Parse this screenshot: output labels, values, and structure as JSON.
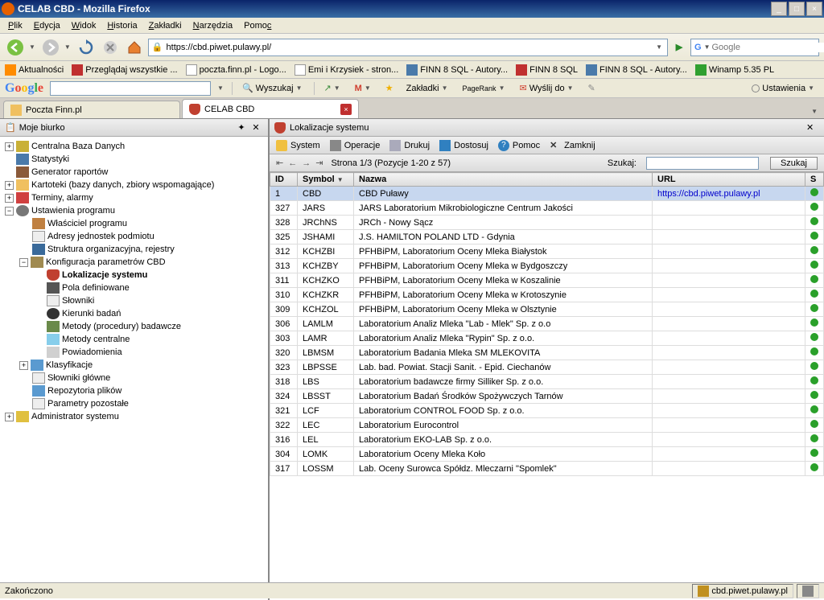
{
  "window": {
    "title": "CELAB CBD - Mozilla Firefox",
    "min": "_",
    "max": "□",
    "close": "×"
  },
  "menubar": [
    "Plik",
    "Edycja",
    "Widok",
    "Historia",
    "Zakładki",
    "Narzędzia",
    "Pomoc"
  ],
  "url": "https://cbd.piwet.pulawy.pl/",
  "search_placeholder": "Google",
  "bookmarks": [
    "Aktualności",
    "Przeglądaj wszystkie ...",
    "poczta.finn.pl - Logo...",
    "Emi i Krzysiek - stron...",
    "FINN 8 SQL - Autory...",
    "FINN 8 SQL",
    "FINN 8 SQL - Autory...",
    "Winamp 5.35 PL"
  ],
  "google": {
    "search": "Wyszukaj",
    "bookmarks": "Zakładki",
    "pagerank": "PageRank",
    "send": "Wyślij do",
    "settings": "Ustawienia"
  },
  "tabs": [
    {
      "label": "Poczta Finn.pl",
      "active": false
    },
    {
      "label": "CELAB CBD",
      "active": true
    }
  ],
  "sidebar": {
    "title": "Moje biurko",
    "tree": {
      "n1": "Centralna Baza Danych",
      "n2": "Statystyki",
      "n3": "Generator raportów",
      "n4": "Kartoteki (bazy danych, zbiory wspomagające)",
      "n5": "Terminy, alarmy",
      "n6": "Ustawienia programu",
      "n7": "Właściciel programu",
      "n8": "Adresy jednostek podmiotu",
      "n9": "Struktura organizacyjna, rejestry",
      "n10": "Konfiguracja parametrów CBD",
      "n11": "Lokalizacje systemu",
      "n12": "Pola definiowane",
      "n13": "Słowniki",
      "n14": "Kierunki badań",
      "n15": "Metody (procedury) badawcze",
      "n16": "Metody centralne",
      "n17": "Powiadomienia",
      "n18": "Klasyfikacje",
      "n19": "Słowniki główne",
      "n20": "Repozytoria plików",
      "n21": "Parametry pozostałe",
      "n22": "Administrator systemu"
    }
  },
  "content": {
    "title": "Lokalizacje systemu",
    "toolbar": {
      "system": "System",
      "ops": "Operacje",
      "print": "Drukuj",
      "adjust": "Dostosuj",
      "help": "Pomoc",
      "close": "Zamknij"
    },
    "pager": {
      "text": "Strona 1/3 (Pozycje 1-20 z 57)",
      "search_label": "Szukaj:",
      "search_btn": "Szukaj"
    },
    "columns": {
      "id": "ID",
      "symbol": "Symbol",
      "nazwa": "Nazwa",
      "url": "URL",
      "s": "S"
    },
    "rows": [
      {
        "id": "1",
        "sym": "CBD",
        "name": "CBD Puławy",
        "url": "https://cbd.piwet.pulawy.pl"
      },
      {
        "id": "327",
        "sym": "JARS",
        "name": "JARS Laboratorium Mikrobiologiczne Centrum Jakości",
        "url": ""
      },
      {
        "id": "328",
        "sym": "JRChNS",
        "name": "JRCh - Nowy Sącz",
        "url": ""
      },
      {
        "id": "325",
        "sym": "JSHAMI",
        "name": "J.S. HAMILTON POLAND LTD - Gdynia",
        "url": ""
      },
      {
        "id": "312",
        "sym": "KCHZBI",
        "name": "PFHBiPM, Laboratorium Oceny Mleka Białystok",
        "url": ""
      },
      {
        "id": "313",
        "sym": "KCHZBY",
        "name": "PFHBiPM, Laboratorium Oceny Mleka w Bydgoszczy",
        "url": ""
      },
      {
        "id": "311",
        "sym": "KCHZKO",
        "name": "PFHBiPM, Laboratorium Oceny Mleka w Koszalinie",
        "url": ""
      },
      {
        "id": "310",
        "sym": "KCHZKR",
        "name": "PFHBiPM, Laboratorium Oceny Mleka w Krotoszynie",
        "url": ""
      },
      {
        "id": "309",
        "sym": "KCHZOL",
        "name": "PFHBiPM, Laboratorium Oceny Mleka w Olsztynie",
        "url": ""
      },
      {
        "id": "306",
        "sym": "LAMLM",
        "name": "Laboratorium Analiz Mleka \"Lab - Mlek\" Sp. z o.o",
        "url": ""
      },
      {
        "id": "303",
        "sym": "LAMR",
        "name": "Laboratorium Analiz Mleka \"Rypin\" Sp. z o.o.",
        "url": ""
      },
      {
        "id": "320",
        "sym": "LBMSM",
        "name": "Laboratorium Badania Mleka SM MLEKOVITA",
        "url": ""
      },
      {
        "id": "323",
        "sym": "LBPSSE",
        "name": "Lab. bad. Powiat. Stacji Sanit. - Epid. Ciechanów",
        "url": ""
      },
      {
        "id": "318",
        "sym": "LBS",
        "name": "Laboratorium badawcze firmy Silliker Sp. z o.o.",
        "url": ""
      },
      {
        "id": "324",
        "sym": "LBSST",
        "name": "Laboratorium Badań Środków Spożywczych Tarnów",
        "url": ""
      },
      {
        "id": "321",
        "sym": "LCF",
        "name": "Laboratorium CONTROL FOOD Sp. z o.o.",
        "url": ""
      },
      {
        "id": "322",
        "sym": "LEC",
        "name": "Laboratorium Eurocontrol",
        "url": ""
      },
      {
        "id": "316",
        "sym": "LEL",
        "name": "Laboratorium EKO-LAB Sp. z o.o.",
        "url": ""
      },
      {
        "id": "304",
        "sym": "LOMK",
        "name": "Laboratorium Oceny Mleka Koło",
        "url": ""
      },
      {
        "id": "317",
        "sym": "LOSSM",
        "name": "Lab. Oceny Surowca Spółdz. Mleczarni \"Spomlek\"",
        "url": ""
      }
    ]
  },
  "statusbar": {
    "left": "Zakończono",
    "right": "cbd.piwet.pulawy.pl"
  }
}
